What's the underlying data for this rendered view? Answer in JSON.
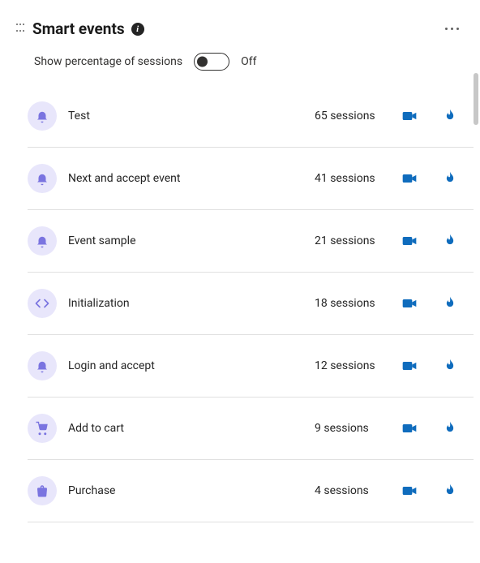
{
  "header": {
    "title": "Smart events"
  },
  "toggle": {
    "label": "Show percentage of sessions",
    "state": "Off"
  },
  "events": [
    {
      "icon": "bell",
      "name": "Test",
      "sessions": "65 sessions"
    },
    {
      "icon": "bell",
      "name": "Next and accept event",
      "sessions": "41 sessions"
    },
    {
      "icon": "bell",
      "name": "Event sample",
      "sessions": "21 sessions"
    },
    {
      "icon": "code",
      "name": "Initialization",
      "sessions": "18 sessions"
    },
    {
      "icon": "bell",
      "name": "Login and accept",
      "sessions": "12 sessions"
    },
    {
      "icon": "cart",
      "name": "Add to cart",
      "sessions": "9 sessions"
    },
    {
      "icon": "bag",
      "name": "Purchase",
      "sessions": "4 sessions"
    }
  ]
}
